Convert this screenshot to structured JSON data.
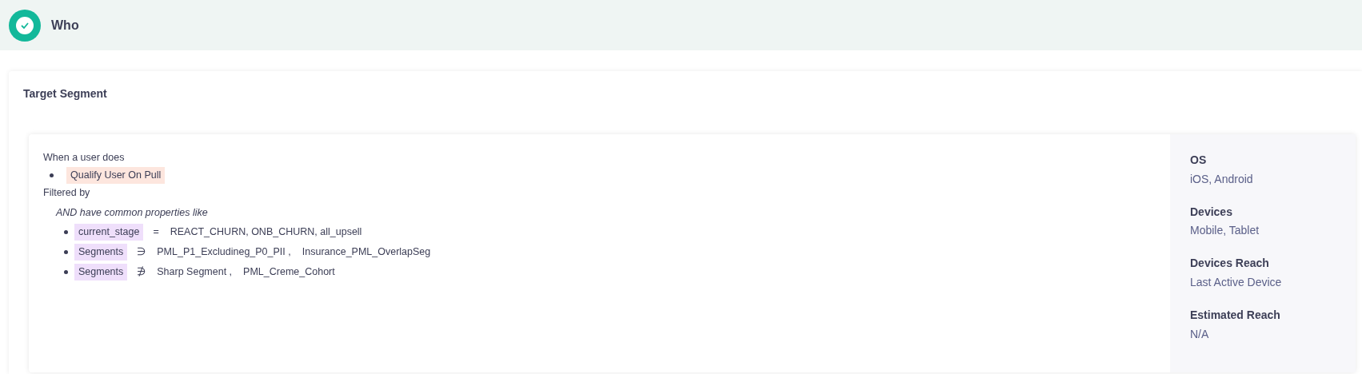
{
  "header": {
    "title": "Who",
    "completed": true
  },
  "section": {
    "title": "Target Segment"
  },
  "rule": {
    "event_label": "When a user does",
    "events": [
      {
        "name": "Qualify User On Pull"
      }
    ],
    "filter_label": "Filtered by",
    "properties_label": "AND have common properties like",
    "properties": [
      {
        "name": "current_stage",
        "operator": "=",
        "values": [
          "REACT_CHURN, ONB_CHURN, all_upsell"
        ]
      },
      {
        "name": "Segments",
        "operator": "∋",
        "values": [
          "PML_P1_Excludineg_P0_PII ,",
          "Insurance_PML_OverlapSeg"
        ]
      },
      {
        "name": "Segments",
        "operator": "∌",
        "values": [
          "Sharp Segment ,",
          "PML_Creme_Cohort"
        ]
      }
    ]
  },
  "summary": [
    {
      "label": "OS",
      "value": "iOS, Android"
    },
    {
      "label": "Devices",
      "value": "Mobile, Tablet"
    },
    {
      "label": "Devices Reach",
      "value": "Last Active Device"
    },
    {
      "label": "Estimated Reach",
      "value": "N/A"
    }
  ]
}
